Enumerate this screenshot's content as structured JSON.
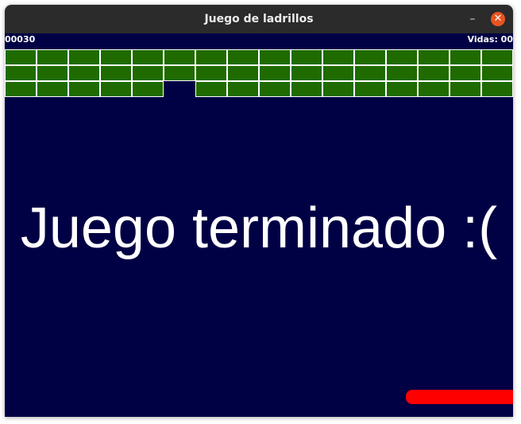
{
  "window": {
    "title": "Juego de ladrillos"
  },
  "hud": {
    "score": "00030",
    "lives": "Vidas: 00"
  },
  "message": "Juego terminado :(",
  "colors": {
    "background": "#000044",
    "brick": "#1f6b00",
    "paddle": "#ff0000"
  },
  "bricks": {
    "rows": 3,
    "cols": 16,
    "missing": [
      [
        2,
        5
      ]
    ]
  }
}
